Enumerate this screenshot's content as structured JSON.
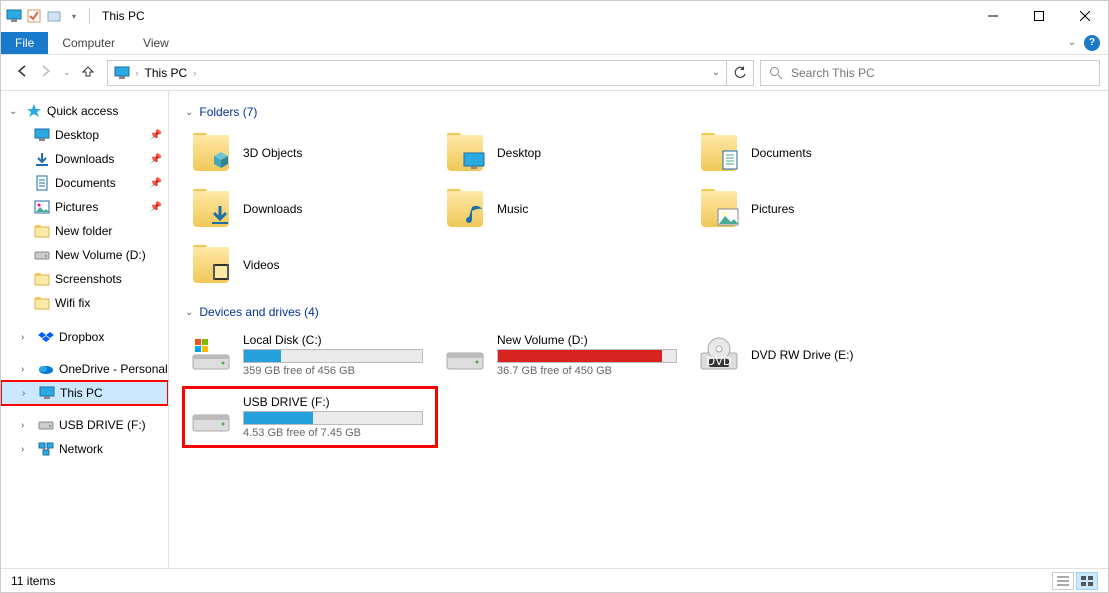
{
  "window": {
    "title": "This PC"
  },
  "ribbon": {
    "file": "File",
    "tabs": [
      "Computer",
      "View"
    ]
  },
  "nav": {
    "breadcrumb": "This PC",
    "search_placeholder": "Search This PC"
  },
  "sidebar": {
    "quick_access": {
      "label": "Quick access",
      "items": [
        {
          "label": "Desktop",
          "pinned": true,
          "icon": "monitor"
        },
        {
          "label": "Downloads",
          "pinned": true,
          "icon": "download"
        },
        {
          "label": "Documents",
          "pinned": true,
          "icon": "document"
        },
        {
          "label": "Pictures",
          "pinned": true,
          "icon": "picture"
        },
        {
          "label": "New folder",
          "pinned": false,
          "icon": "folder"
        },
        {
          "label": "New Volume (D:)",
          "pinned": false,
          "icon": "drive"
        },
        {
          "label": "Screenshots",
          "pinned": false,
          "icon": "folder"
        },
        {
          "label": "Wifi fix",
          "pinned": false,
          "icon": "folder"
        }
      ]
    },
    "roots": [
      {
        "label": "Dropbox",
        "icon": "dropbox"
      },
      {
        "label": "OneDrive - Personal",
        "icon": "onedrive"
      },
      {
        "label": "This PC",
        "icon": "monitor",
        "selected": true,
        "highlight": true
      },
      {
        "label": "USB DRIVE (F:)",
        "icon": "usb"
      },
      {
        "label": "Network",
        "icon": "network"
      }
    ]
  },
  "sections": {
    "folders": {
      "title": "Folders (7)",
      "items": [
        {
          "label": "3D Objects",
          "overlay": "cube"
        },
        {
          "label": "Desktop",
          "overlay": "monitor"
        },
        {
          "label": "Documents",
          "overlay": "document"
        },
        {
          "label": "Downloads",
          "overlay": "download"
        },
        {
          "label": "Music",
          "overlay": "music"
        },
        {
          "label": "Pictures",
          "overlay": "picture"
        },
        {
          "label": "Videos",
          "overlay": "video"
        }
      ]
    },
    "drives": {
      "title": "Devices and drives (4)",
      "items": [
        {
          "label": "Local Disk (C:)",
          "free_text": "359 GB free of 456 GB",
          "fill_pct": 21,
          "fill_color": "#26a0da",
          "icon": "windisk"
        },
        {
          "label": "New Volume (D:)",
          "free_text": "36.7 GB free of 450 GB",
          "fill_pct": 92,
          "fill_color": "#d82323",
          "icon": "disk"
        },
        {
          "label": "DVD RW Drive (E:)",
          "free_text": "",
          "fill_pct": null,
          "fill_color": "",
          "icon": "dvd"
        },
        {
          "label": "USB DRIVE (F:)",
          "free_text": "4.53 GB free of 7.45 GB",
          "fill_pct": 39,
          "fill_color": "#26a0da",
          "icon": "disk",
          "highlight": true
        }
      ]
    }
  },
  "status": {
    "count": "11 items"
  }
}
